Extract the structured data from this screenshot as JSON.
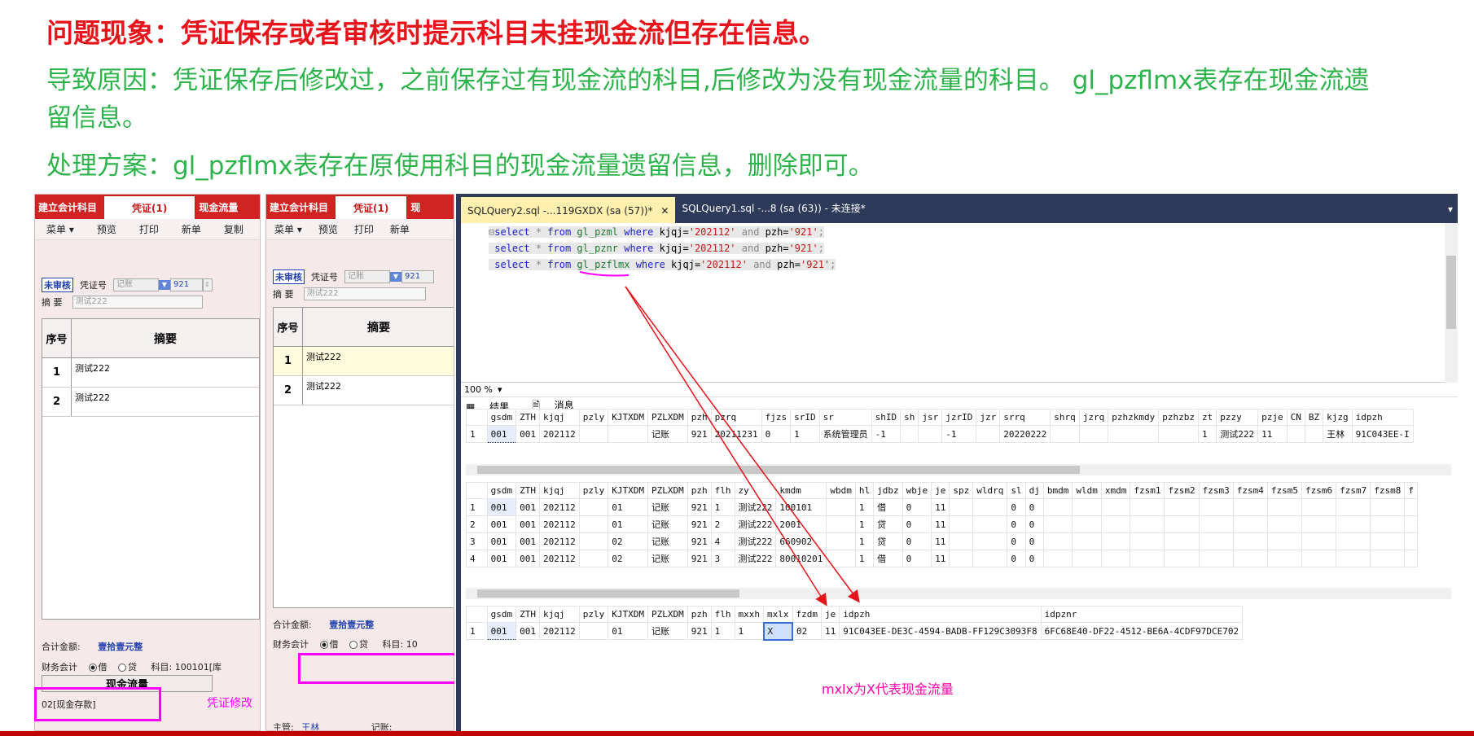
{
  "slide": {
    "heading": "问题现象：凭证保存或者审核时提示科目未挂现金流但存在信息。",
    "cause": "导致原因：凭证保存后修改过，之前保存过有现金流的科目,后修改为没有现金流量的科目。 gl_pzflmx表存在现金流遗留信息。",
    "solution": "处理方案：gl_pzflmx表存在原使用科目的现金流量遗留信息，删除即可。",
    "note": "mxlx为X代表现金流量"
  },
  "erp_left": {
    "tabs": [
      "建立会计科目",
      "凭证(1)",
      "现金流量"
    ],
    "toolbar": [
      "菜单 ▾",
      "预览",
      "打印",
      "新单",
      "复制"
    ],
    "status": "未审核",
    "voucher_label": "凭证号",
    "voucher_type": "记账",
    "voucher_no": "921",
    "summary_label": "摘  要",
    "summary_value": "测试222",
    "grid_hdr_no": "序号",
    "grid_hdr_summary": "摘要",
    "rows": [
      {
        "no": "1",
        "text": "测试222"
      },
      {
        "no": "2",
        "text": "测试222"
      }
    ],
    "total_label": "合计金额:",
    "total_value": "壹拾壹元整",
    "acct_label": "财务会计",
    "debit": "借",
    "credit": "贷",
    "subject": "科目: 100101[库",
    "cash_hdr": "现金流量",
    "cash_value": "02[现金存款]",
    "side_note": "凭证修改"
  },
  "erp_mid": {
    "tabs": [
      "建立会计科目",
      "凭证(1)",
      "现"
    ],
    "toolbar": [
      "菜单 ▾",
      "预览",
      "打印",
      "新单"
    ],
    "status": "未审核",
    "voucher_label": "凭证号",
    "voucher_type": "记账",
    "voucher_no": "921",
    "summary_label": "摘  要",
    "summary_value": "测试222",
    "grid_hdr_no": "序号",
    "grid_hdr_summary": "摘要",
    "rows": [
      {
        "no": "1",
        "text": "测试222"
      },
      {
        "no": "2",
        "text": "测试222"
      }
    ],
    "total_label": "合计金额:",
    "total_value": "壹拾壹元整",
    "acct_label": "财务会计",
    "debit": "借",
    "credit": "贷",
    "subject": "科目: 10",
    "manager_label": "主管:",
    "manager": "王林",
    "bookkeeper_label": "记账:"
  },
  "ssms": {
    "tabs": [
      "SQLQuery2.sql -...119GXDX (sa (57))*",
      "SQLQuery1.sql -...8 (sa (63)) - 未连接*"
    ],
    "sql": [
      {
        "kw1": "select",
        "mid": " * ",
        "kw2": "from",
        "tbl": "gl_pzml",
        "kw3": "where",
        "c1": "kjqj=",
        "v1": "'202112'",
        "and": "and",
        "c2": "pzh=",
        "v2": "'921'"
      },
      {
        "kw1": "select",
        "mid": " * ",
        "kw2": "from",
        "tbl": "gl_pznr",
        "kw3": "where",
        "c1": "kjqj=",
        "v1": "'202112'",
        "and": "and",
        "c2": "pzh=",
        "v2": "'921'"
      },
      {
        "kw1": "select",
        "mid": " * ",
        "kw2": "from",
        "tbl": "gl_pzflmx",
        "kw3": "where",
        "c1": "kjqj=",
        "v1": "'202112'",
        "and": "and",
        "c2": "pzh=",
        "v2": "'921'"
      }
    ],
    "zoom": "100 %",
    "tab_results": "结果",
    "tab_messages": "消息",
    "grid1": {
      "headers": [
        "",
        "gsdm",
        "ZTH",
        "kjqj",
        "pzly",
        "KJTXDM",
        "PZLXDM",
        "pzh",
        "pzrq",
        "fjzs",
        "srID",
        "sr",
        "shID",
        "sh",
        "jsr",
        "jzrID",
        "jzr",
        "srrq",
        "shrq",
        "jzrq",
        "pzhzkmdy",
        "pzhzbz",
        "zt",
        "pzzy",
        "pzje",
        "CN",
        "BZ",
        "kjzg",
        "idpzh"
      ],
      "rows": [
        [
          "1",
          "001",
          "001",
          "202112",
          "",
          "",
          "记账",
          "921",
          "20211231",
          "0",
          "1",
          "系统管理员",
          "-1",
          "",
          "",
          "-1",
          "",
          "20220222",
          "",
          "",
          "",
          "",
          "1",
          "测试222",
          "11",
          "",
          "",
          "王林",
          "91C043EE-I"
        ]
      ]
    },
    "grid2": {
      "headers": [
        "",
        "gsdm",
        "ZTH",
        "kjqj",
        "pzly",
        "KJTXDM",
        "PZLXDM",
        "pzh",
        "flh",
        "zy",
        "kmdm",
        "wbdm",
        "hl",
        "jdbz",
        "wbje",
        "je",
        "spz",
        "wldrq",
        "sl",
        "dj",
        "bmdm",
        "wldm",
        "xmdm",
        "fzsm1",
        "fzsm2",
        "fzsm3",
        "fzsm4",
        "fzsm5",
        "fzsm6",
        "fzsm7",
        "fzsm8",
        "f"
      ],
      "rows": [
        [
          "1",
          "001",
          "001",
          "202112",
          "",
          "01",
          "记账",
          "921",
          "1",
          "测试222",
          "100101",
          "",
          "1",
          "借",
          "0",
          "11",
          "",
          "",
          "0",
          "0",
          "",
          "",
          "",
          "",
          "",
          "",
          "",
          "",
          "",
          "",
          "",
          ""
        ],
        [
          "2",
          "001",
          "001",
          "202112",
          "",
          "01",
          "记账",
          "921",
          "2",
          "测试222",
          "2001",
          "",
          "1",
          "贷",
          "0",
          "11",
          "",
          "",
          "0",
          "0",
          "",
          "",
          "",
          "",
          "",
          "",
          "",
          "",
          "",
          "",
          "",
          ""
        ],
        [
          "3",
          "001",
          "001",
          "202112",
          "",
          "02",
          "记账",
          "921",
          "4",
          "测试222",
          "660902",
          "",
          "1",
          "贷",
          "0",
          "11",
          "",
          "",
          "0",
          "0",
          "",
          "",
          "",
          "",
          "",
          "",
          "",
          "",
          "",
          "",
          "",
          ""
        ],
        [
          "4",
          "001",
          "001",
          "202112",
          "",
          "02",
          "记账",
          "921",
          "3",
          "测试222",
          "80010201",
          "",
          "1",
          "借",
          "0",
          "11",
          "",
          "",
          "0",
          "0",
          "",
          "",
          "",
          "",
          "",
          "",
          "",
          "",
          "",
          "",
          "",
          ""
        ]
      ]
    },
    "grid3": {
      "headers": [
        "",
        "gsdm",
        "ZTH",
        "kjqj",
        "pzly",
        "KJTXDM",
        "PZLXDM",
        "pzh",
        "flh",
        "mxxh",
        "mxlx",
        "fzdm",
        "je",
        "idpzh",
        "idpznr"
      ],
      "rows": [
        [
          "1",
          "001",
          "001",
          "202112",
          "",
          "01",
          "记账",
          "921",
          "1",
          "1",
          "X",
          "02",
          "11",
          "91C043EE-DE3C-4594-BADB-FF129C3093F8",
          "6FC68E40-DF22-4512-BE6A-4CDF97DCE702"
        ]
      ]
    }
  },
  "colors": {
    "heading": "#e8141b",
    "green": "#2fb34c",
    "annotation": "#ff00ff",
    "arrow": "#e8141b"
  }
}
